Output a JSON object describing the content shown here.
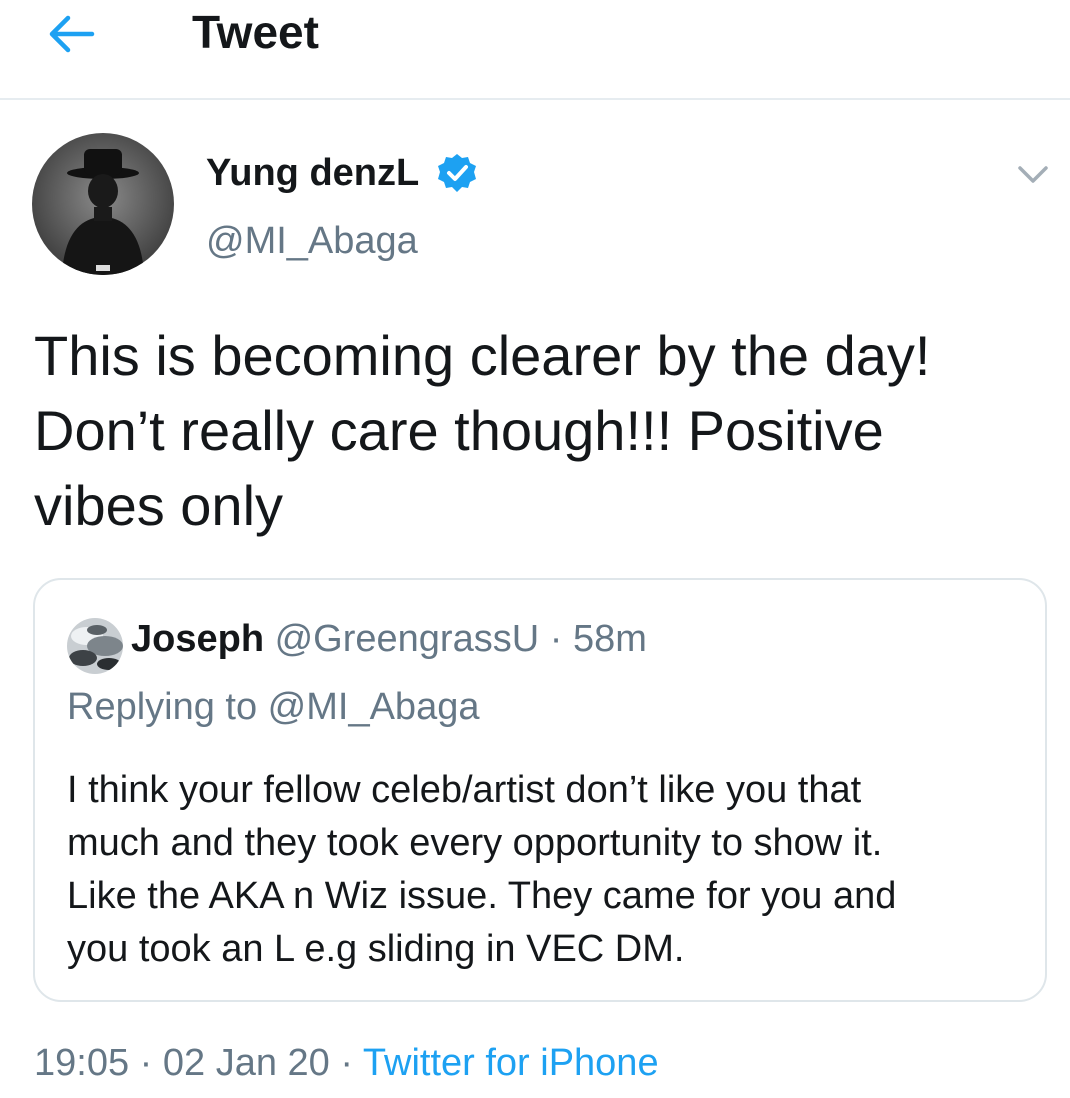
{
  "header": {
    "back_icon": "arrow-left-icon",
    "title": "Tweet"
  },
  "tweet": {
    "display_name": "Yung denzL",
    "verified_icon": "verified-badge-icon",
    "handle": "@MI_Abaga",
    "more_icon": "chevron-down-icon",
    "text": "This is becoming clearer by the day!\nDon’t really care though!!! Positive\nvibes only"
  },
  "quoted_tweet": {
    "name": "Joseph",
    "handle": "@GreengrassU",
    "separator": "·",
    "time": "58m",
    "replying_to": "Replying to @MI_Abaga",
    "text": "I think your fellow celeb/artist don’t like you that\nmuch and they took every opportunity to show it.\nLike the AKA n Wiz issue. They came for you and\nyou took an L e.g sliding in VEC DM."
  },
  "meta": {
    "time": "19:05",
    "separator": "·",
    "date": "02 Jan 20",
    "source": "Twitter for iPhone"
  },
  "colors": {
    "accent": "#1da1f2",
    "text_primary": "#14171a",
    "text_secondary": "#657786",
    "border": "#e6ecf0"
  }
}
